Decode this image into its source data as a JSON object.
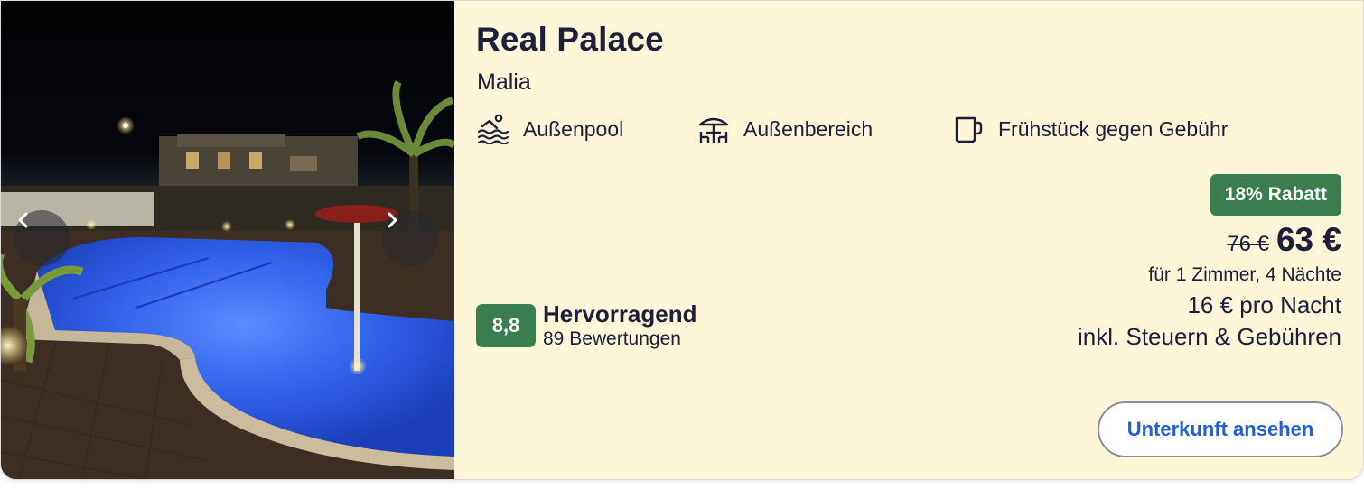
{
  "hotel": {
    "name": "Real Palace",
    "location": "Malia"
  },
  "amenities": [
    {
      "icon": "pool-icon",
      "label": "Außenpool"
    },
    {
      "icon": "outdoor-area-icon",
      "label": "Außenbereich"
    },
    {
      "icon": "coffee-cup-icon",
      "label": "Frühstück gegen Gebühr"
    }
  ],
  "rating": {
    "score": "8,8",
    "label": "Hervorragend",
    "count": "89 Bewertungen"
  },
  "price": {
    "discount_badge": "18% Rabatt",
    "old_price": "76 €",
    "new_price": "63 €",
    "note": "für 1 Zimmer, 4 Nächte",
    "per_night": "16 € pro Nacht",
    "taxes": "inkl. Steuern & Gebühren"
  },
  "cta": {
    "label": "Unterkunft ansehen"
  },
  "gallery": {
    "prev_icon": "chevron-left-icon",
    "next_icon": "chevron-right-icon"
  },
  "colors": {
    "card_background": "#fdf6d8",
    "badge_green": "#3a7d4f",
    "text_dark": "#1c1e3a",
    "link_blue": "#1f5fd8"
  }
}
